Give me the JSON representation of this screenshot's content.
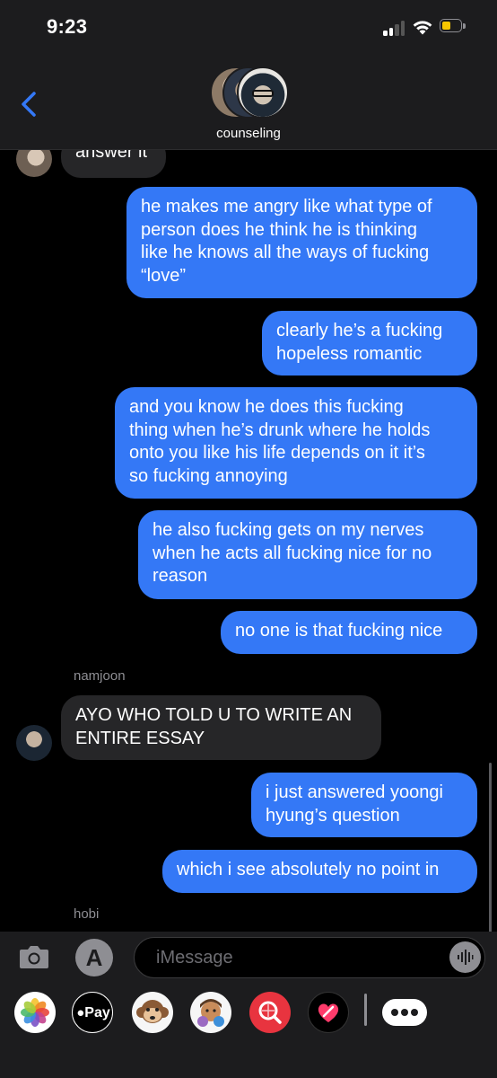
{
  "status_bar": {
    "time": "9:23",
    "battery_level": 0.45,
    "battery_color": "#f7c600"
  },
  "header": {
    "group_name": "counseling",
    "back_icon": "chevron-left-icon"
  },
  "messages": [
    {
      "type": "received",
      "text": "answer it"
    },
    {
      "type": "sent",
      "text": "he makes me angry like what type of\nperson does he think he is thinking\nlike he knows all the ways of fucking\n“love”"
    },
    {
      "type": "sent",
      "text": "clearly he’s a fucking\nhopeless romantic"
    },
    {
      "type": "sent",
      "text": "and you know he does this fucking\nthing when he’s drunk where he holds\nonto you like his life depends on it it’s\nso fucking annoying"
    },
    {
      "type": "sent",
      "text": "he also fucking gets on my nerves\nwhen he acts all fucking nice for no\nreason"
    },
    {
      "type": "sent",
      "text": "no one is that fucking nice"
    },
    {
      "type": "sender_label",
      "text": "namjoon"
    },
    {
      "type": "received",
      "text": "AYO WHO TOLD U TO WRITE AN\nENTIRE ESSAY"
    },
    {
      "type": "sent",
      "text": "i just answered yoongi\nhyung’s question"
    },
    {
      "type": "sent",
      "text": "which i see absolutely no point in"
    },
    {
      "type": "sender_label",
      "text": "hobi"
    }
  ],
  "input": {
    "placeholder": "iMessage",
    "value": ""
  },
  "drawer": {
    "apps": [
      "photos-icon",
      "apple-pay-icon",
      "memoji-monkey-icon",
      "memoji-icon",
      "image-search-icon",
      "digital-touch-icon",
      "more-icon"
    ],
    "apple_pay_label": "Pay"
  },
  "colors": {
    "sent_bubble": "#3478f6",
    "received_bubble": "#262628",
    "background": "#000000"
  }
}
